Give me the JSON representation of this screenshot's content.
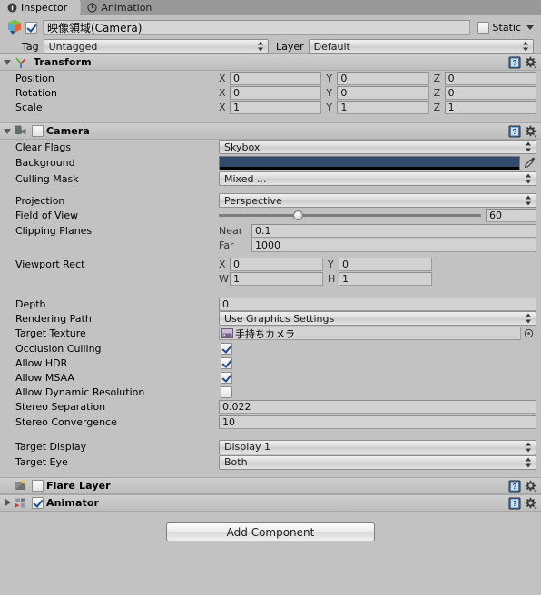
{
  "window": {
    "tabs": [
      {
        "label": "Inspector",
        "icon": "info-icon",
        "active": true
      },
      {
        "label": "Animation",
        "icon": "clock-icon",
        "active": false
      }
    ]
  },
  "gameobject": {
    "icon": "prefab-cube-icon",
    "enabled": true,
    "name": "映像領域(Camera)",
    "static_label": "Static",
    "static_checked": false,
    "tag_label": "Tag",
    "tag_value": "Untagged",
    "layer_label": "Layer",
    "layer_value": "Default"
  },
  "components": [
    {
      "name": "transform",
      "title": "Transform",
      "icon": "transform-axis-icon",
      "expanded": true,
      "has_enable_checkbox": false,
      "rows": [
        {
          "label": "Position",
          "type": "vector3",
          "axes": [
            {
              "axis": "X",
              "value": "0"
            },
            {
              "axis": "Y",
              "value": "0"
            },
            {
              "axis": "Z",
              "value": "0"
            }
          ]
        },
        {
          "label": "Rotation",
          "type": "vector3",
          "axes": [
            {
              "axis": "X",
              "value": "0"
            },
            {
              "axis": "Y",
              "value": "0"
            },
            {
              "axis": "Z",
              "value": "0"
            }
          ]
        },
        {
          "label": "Scale",
          "type": "vector3",
          "axes": [
            {
              "axis": "X",
              "value": "1"
            },
            {
              "axis": "Y",
              "value": "1"
            },
            {
              "axis": "Z",
              "value": "1"
            }
          ]
        }
      ]
    },
    {
      "name": "camera",
      "title": "Camera",
      "icon": "camera-icon",
      "expanded": true,
      "has_enable_checkbox": true,
      "enabled": false
    },
    {
      "name": "flare-layer",
      "title": "Flare Layer",
      "icon": "flare-layer-icon",
      "expanded": false,
      "has_enable_checkbox": true,
      "enabled": false,
      "has_foldout": false
    },
    {
      "name": "animator",
      "title": "Animator",
      "icon": "animator-icon",
      "expanded": false,
      "has_enable_checkbox": true,
      "enabled": true,
      "has_foldout": true
    }
  ],
  "camera_fields": {
    "clear_flags": {
      "label": "Clear Flags",
      "value": "Skybox"
    },
    "background": {
      "label": "Background",
      "color": "#334b6b"
    },
    "culling_mask": {
      "label": "Culling Mask",
      "value": "Mixed ..."
    },
    "projection": {
      "label": "Projection",
      "value": "Perspective"
    },
    "field_of_view": {
      "label": "Field of View",
      "value": "60",
      "slider_pct": 30
    },
    "clipping_planes": {
      "label": "Clipping Planes",
      "near_label": "Near",
      "near_value": "0.1",
      "far_label": "Far",
      "far_value": "1000"
    },
    "viewport_rect": {
      "label": "Viewport Rect",
      "x_label": "X",
      "x_value": "0",
      "y_label": "Y",
      "y_value": "0",
      "w_label": "W",
      "w_value": "1",
      "h_label": "H",
      "h_value": "1"
    },
    "depth": {
      "label": "Depth",
      "value": "0"
    },
    "rendering_path": {
      "label": "Rendering Path",
      "value": "Use Graphics Settings"
    },
    "target_texture": {
      "label": "Target Texture",
      "value": "手持ちカメラ",
      "icon": "render-texture-icon"
    },
    "occlusion_culling": {
      "label": "Occlusion Culling",
      "checked": true
    },
    "allow_hdr": {
      "label": "Allow HDR",
      "checked": true
    },
    "allow_msaa": {
      "label": "Allow MSAA",
      "checked": true
    },
    "allow_dynamic_resolution": {
      "label": "Allow Dynamic Resolution",
      "checked": false
    },
    "stereo_separation": {
      "label": "Stereo Separation",
      "value": "0.022"
    },
    "stereo_convergence": {
      "label": "Stereo Convergence",
      "value": "10"
    },
    "target_display": {
      "label": "Target Display",
      "value": "Display 1"
    },
    "target_eye": {
      "label": "Target Eye",
      "value": "Both"
    }
  },
  "footer": {
    "add_component_label": "Add Component"
  }
}
